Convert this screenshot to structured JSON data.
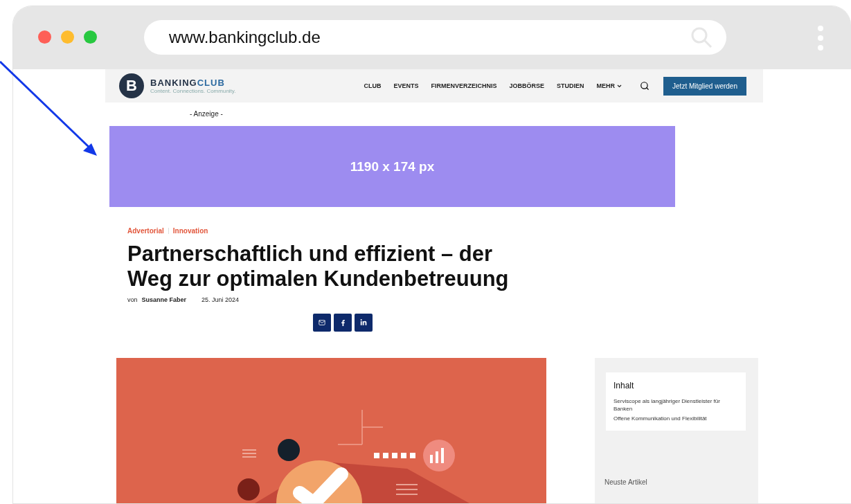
{
  "browser": {
    "url": "www.bankingclub.de"
  },
  "header": {
    "logo_letter": "B",
    "logo_word_1": "BANKING",
    "logo_word_2": "CLUB",
    "tagline": "Content. Connections. Community.",
    "nav": [
      {
        "label": "CLUB",
        "dropdown": false
      },
      {
        "label": "EVENTS",
        "dropdown": false
      },
      {
        "label": "FIRMENVERZEICHNIS",
        "dropdown": false
      },
      {
        "label": "JOBBÖRSE",
        "dropdown": false
      },
      {
        "label": "STUDIEN",
        "dropdown": false
      },
      {
        "label": "MEHR",
        "dropdown": true
      }
    ],
    "cta": "Jetzt Mitglied werden"
  },
  "ad": {
    "label": "- Anzeige -",
    "size": "1190 x 174 px"
  },
  "article": {
    "categories": [
      "Advertorial",
      "Innovation"
    ],
    "title": "Partnerschaftlich und effizient – der Weg zur optimalen Kundenbetreuung",
    "by": "von",
    "author": "Susanne Faber",
    "date": "25. Juni 2024",
    "share": [
      {
        "kind": "mail"
      },
      {
        "kind": "facebook"
      },
      {
        "kind": "linkedin"
      }
    ],
    "image": {
      "kind": "picture"
    }
  },
  "sidebar": {
    "toc_title": "Inhalt",
    "toc": [
      "Serviscope als langjähriger Dienstleister für Banken",
      "Offene Kommunikation und Flexibilität"
    ],
    "latest_title": "Neuste Artikel"
  }
}
